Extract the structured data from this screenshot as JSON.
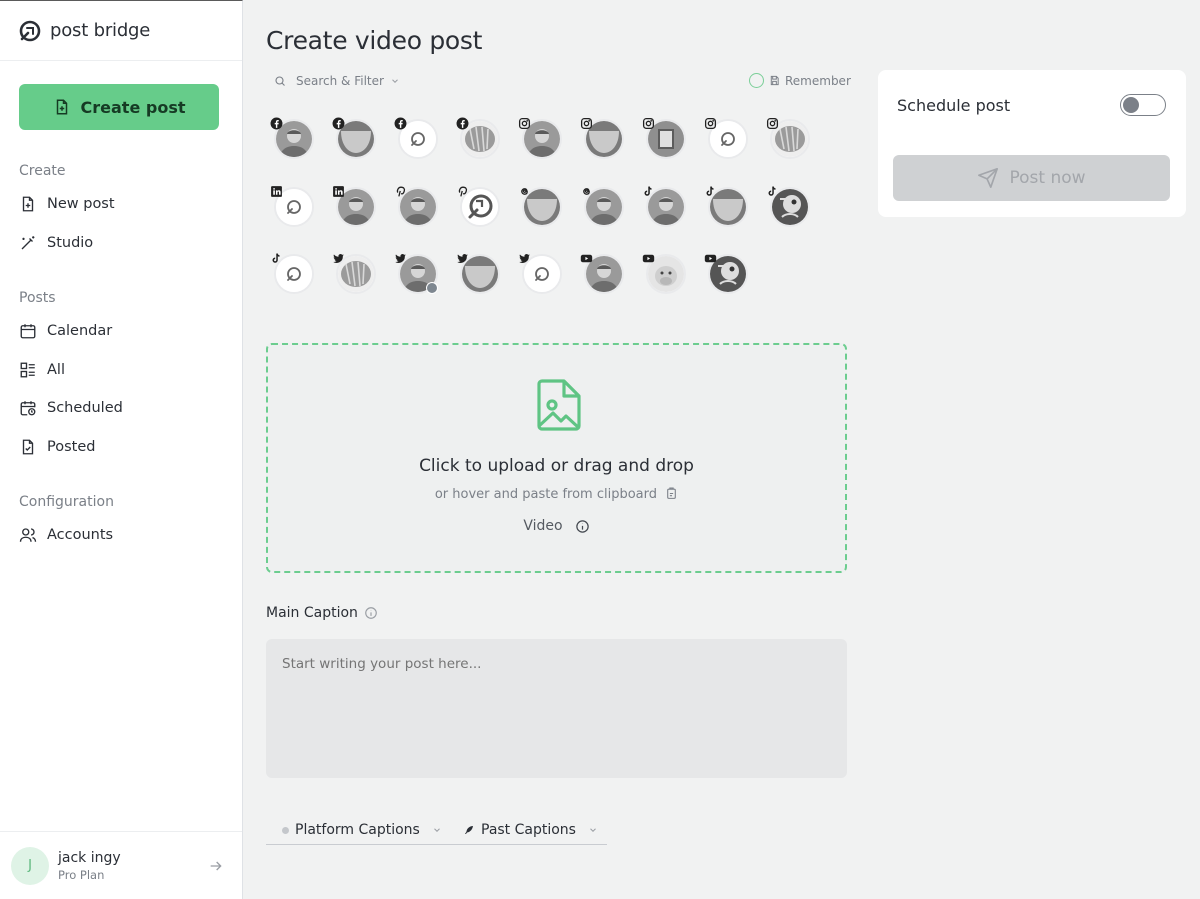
{
  "app": {
    "brand": "post bridge"
  },
  "sidebar": {
    "create_button": "Create post",
    "sections": {
      "create": "Create",
      "posts": "Posts",
      "configuration": "Configuration"
    },
    "items": [
      {
        "label": "New post",
        "icon": "file-plus-icon"
      },
      {
        "label": "Studio",
        "icon": "magic-wand-icon"
      },
      {
        "label": "Calendar",
        "icon": "calendar-icon"
      },
      {
        "label": "All",
        "icon": "list-icon"
      },
      {
        "label": "Scheduled",
        "icon": "calendar-clock-icon"
      },
      {
        "label": "Posted",
        "icon": "file-check-icon"
      },
      {
        "label": "Accounts",
        "icon": "users-icon"
      }
    ],
    "user": {
      "initial": "J",
      "name": "jack ingy",
      "plan": "Pro Plan"
    }
  },
  "main": {
    "title": "Create video post",
    "filter_label": "Search & Filter",
    "remember_label": "Remember",
    "accounts": [
      {
        "platform": "facebook",
        "avatar": "photo"
      },
      {
        "platform": "facebook",
        "avatar": "blob"
      },
      {
        "platform": "facebook",
        "avatar": "logo"
      },
      {
        "platform": "facebook",
        "avatar": "stripes"
      },
      {
        "platform": "instagram",
        "avatar": "photo"
      },
      {
        "platform": "instagram",
        "avatar": "blob"
      },
      {
        "platform": "instagram",
        "avatar": "book"
      },
      {
        "platform": "instagram",
        "avatar": "logo"
      },
      {
        "platform": "instagram",
        "avatar": "stripes"
      },
      {
        "platform": "linkedin",
        "avatar": "logo"
      },
      {
        "platform": "linkedin",
        "avatar": "photo"
      },
      {
        "platform": "pinterest",
        "avatar": "photo"
      },
      {
        "platform": "pinterest",
        "avatar": "logo-large"
      },
      {
        "platform": "threads",
        "avatar": "blob"
      },
      {
        "platform": "threads",
        "avatar": "photo"
      },
      {
        "platform": "tiktok",
        "avatar": "photo"
      },
      {
        "platform": "tiktok",
        "avatar": "blob"
      },
      {
        "platform": "tiktok",
        "avatar": "cartoon"
      },
      {
        "platform": "tiktok",
        "avatar": "logo"
      },
      {
        "platform": "twitter",
        "avatar": "stripes"
      },
      {
        "platform": "twitter",
        "avatar": "photo",
        "verified": true
      },
      {
        "platform": "twitter",
        "avatar": "blob"
      },
      {
        "platform": "twitter",
        "avatar": "logo"
      },
      {
        "platform": "youtube",
        "avatar": "photo"
      },
      {
        "platform": "youtube",
        "avatar": "cow"
      },
      {
        "platform": "youtube",
        "avatar": "cartoon"
      }
    ],
    "upload": {
      "title": "Click to upload or drag and drop",
      "subtitle": "or hover and paste from clipboard",
      "type": "Video"
    },
    "caption": {
      "label": "Main Caption",
      "placeholder": "Start writing your post here..."
    },
    "caption_tabs": [
      "Platform Captions",
      "Past Captions"
    ]
  },
  "schedule": {
    "label": "Schedule post",
    "enabled": false,
    "post_now": "Post now"
  },
  "colors": {
    "accent": "#66cc8a",
    "dropzone_border": "#6ccd8f",
    "background": "#f1f2f2"
  }
}
